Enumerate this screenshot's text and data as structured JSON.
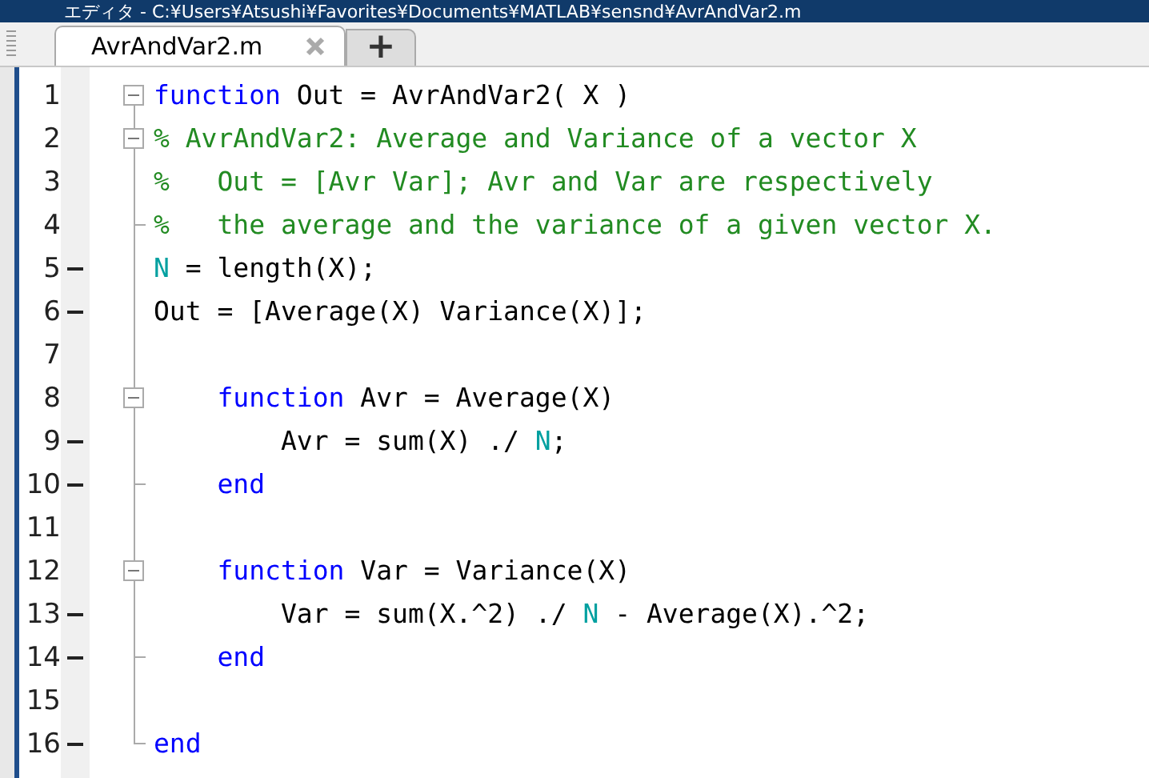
{
  "window": {
    "title": "エディタ - C:¥Users¥Atsushi¥Favorites¥Documents¥MATLAB¥sensnd¥AvrAndVar2.m"
  },
  "tabs": [
    {
      "label": "AvrAndVar2.m",
      "selected": true
    }
  ],
  "new_tab_button": "+",
  "code_lines": [
    {
      "number": "1",
      "executable": false,
      "fold_start": true,
      "fold_end": false,
      "tokens": [
        {
          "kind": "keyword",
          "text": "function"
        },
        {
          "kind": "plain",
          "text": " Out = AvrAndVar2( X )"
        }
      ]
    },
    {
      "number": "2",
      "executable": false,
      "fold_start": true,
      "fold_end": false,
      "tokens": [
        {
          "kind": "comment",
          "text": "% AvrAndVar2: Average and Variance of a vector X"
        }
      ]
    },
    {
      "number": "3",
      "executable": false,
      "fold_start": false,
      "fold_end": false,
      "tokens": [
        {
          "kind": "comment",
          "text": "%   Out = [Avr Var]; Avr and Var are respectively"
        }
      ]
    },
    {
      "number": "4",
      "executable": false,
      "fold_start": false,
      "fold_end": true,
      "tokens": [
        {
          "kind": "comment",
          "text": "%   the average and the variance of a given vector X."
        }
      ]
    },
    {
      "number": "5",
      "executable": true,
      "fold_start": false,
      "fold_end": false,
      "tokens": [
        {
          "kind": "variable",
          "text": "N"
        },
        {
          "kind": "plain",
          "text": " = length(X);"
        }
      ]
    },
    {
      "number": "6",
      "executable": true,
      "fold_start": false,
      "fold_end": false,
      "tokens": [
        {
          "kind": "plain",
          "text": "Out = [Average(X) Variance(X)];"
        }
      ]
    },
    {
      "number": "7",
      "executable": false,
      "fold_start": false,
      "fold_end": false
    },
    {
      "number": "8",
      "executable": false,
      "fold_start": true,
      "fold_end": false,
      "tokens": [
        {
          "kind": "keyword",
          "text": "    function"
        },
        {
          "kind": "plain",
          "text": " Avr = Average(X)"
        }
      ]
    },
    {
      "number": "9",
      "executable": true,
      "fold_start": false,
      "fold_end": false,
      "tokens": [
        {
          "kind": "plain",
          "text": "        Avr = sum(X) ./ "
        },
        {
          "kind": "variable",
          "text": "N"
        },
        {
          "kind": "plain",
          "text": ";"
        }
      ]
    },
    {
      "number": "10",
      "executable": true,
      "fold_start": false,
      "fold_end": true,
      "tokens": [
        {
          "kind": "keyword",
          "text": "    end"
        }
      ]
    },
    {
      "number": "11",
      "executable": false,
      "fold_start": false,
      "fold_end": false
    },
    {
      "number": "12",
      "executable": false,
      "fold_start": true,
      "fold_end": false,
      "tokens": [
        {
          "kind": "keyword",
          "text": "    function"
        },
        {
          "kind": "plain",
          "text": " Var = Variance(X)"
        }
      ]
    },
    {
      "number": "13",
      "executable": true,
      "fold_start": false,
      "fold_end": false,
      "tokens": [
        {
          "kind": "plain",
          "text": "        Var = sum(X.^2) ./ "
        },
        {
          "kind": "variable",
          "text": "N"
        },
        {
          "kind": "plain",
          "text": " - Average(X).^2;"
        }
      ]
    },
    {
      "number": "14",
      "executable": true,
      "fold_start": false,
      "fold_end": true,
      "tokens": [
        {
          "kind": "keyword",
          "text": "    end"
        }
      ]
    },
    {
      "number": "15",
      "executable": false,
      "fold_start": false,
      "fold_end": false
    },
    {
      "number": "16",
      "executable": true,
      "fold_start": false,
      "fold_end": true,
      "tokens": [
        {
          "kind": "keyword",
          "text": "end"
        }
      ]
    }
  ]
}
